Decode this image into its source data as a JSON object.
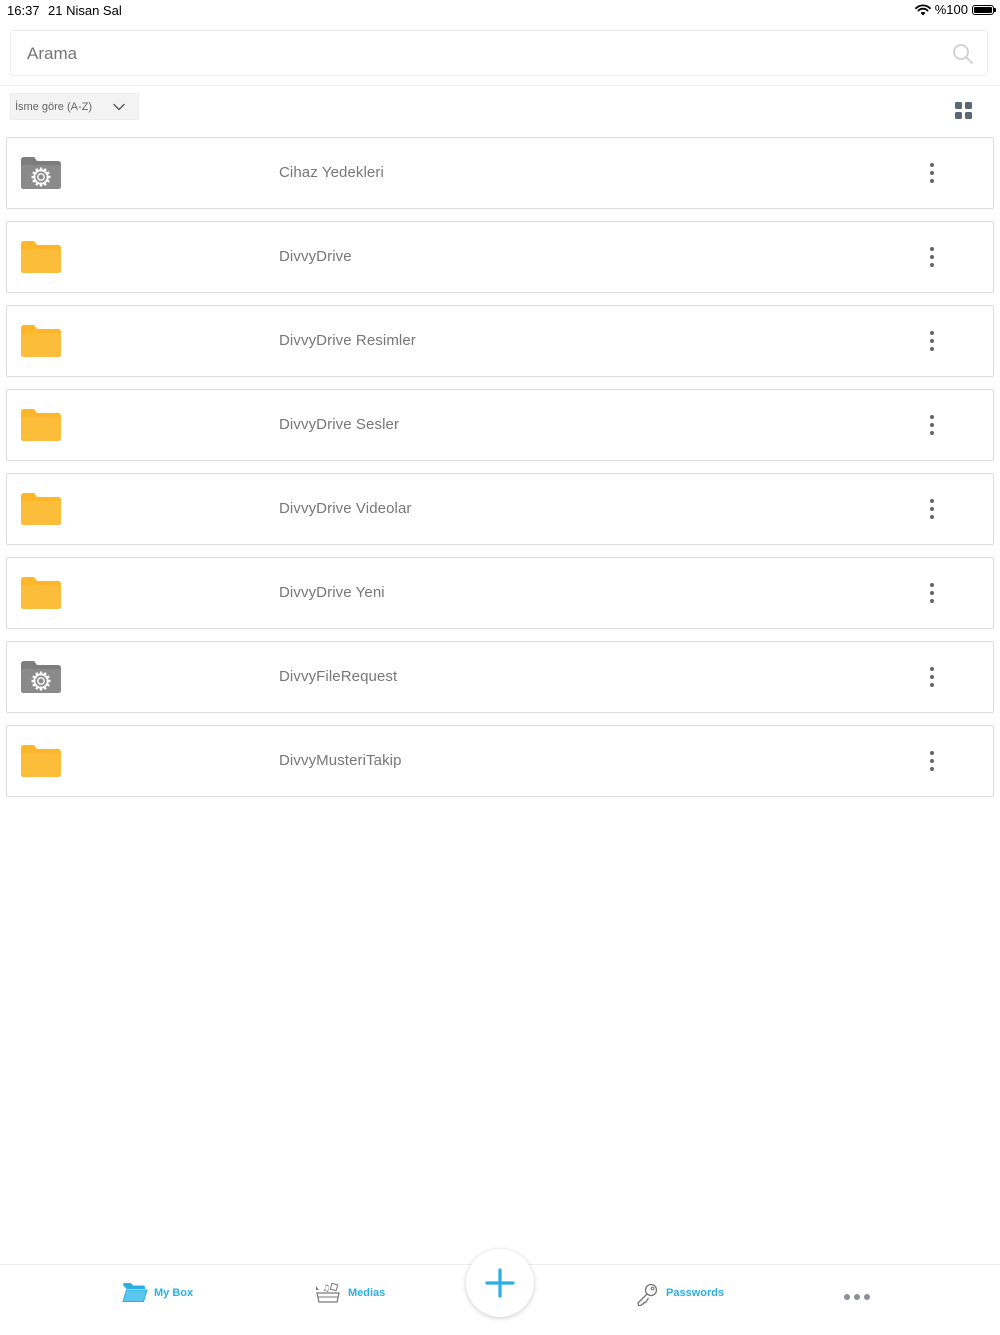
{
  "status_bar": {
    "time": "16:37",
    "date": "21 Nisan Sal",
    "battery": "%100"
  },
  "search": {
    "placeholder": "Arama"
  },
  "sort": {
    "selected": "İsme göre (A-Z)"
  },
  "folders": [
    {
      "name": "Cihaz Yedekleri",
      "icon": "system-folder-icon"
    },
    {
      "name": "DivvyDrive",
      "icon": "folder-icon"
    },
    {
      "name": "DivvyDrive Resimler",
      "icon": "folder-icon"
    },
    {
      "name": "DivvyDrive Sesler",
      "icon": "folder-icon"
    },
    {
      "name": "DivvyDrive Videolar",
      "icon": "folder-icon"
    },
    {
      "name": "DivvyDrive Yeni",
      "icon": "folder-icon"
    },
    {
      "name": "DivvyFileRequest",
      "icon": "system-folder-icon"
    },
    {
      "name": "DivvyMusteriTakip",
      "icon": "folder-icon"
    }
  ],
  "tabs": {
    "my_box": "My Box",
    "medias": "Medias",
    "passwords": "Passwords"
  },
  "colors": {
    "accent": "#2baee3",
    "folder": "#fdb52a",
    "system_folder": "#8a8a8a"
  }
}
